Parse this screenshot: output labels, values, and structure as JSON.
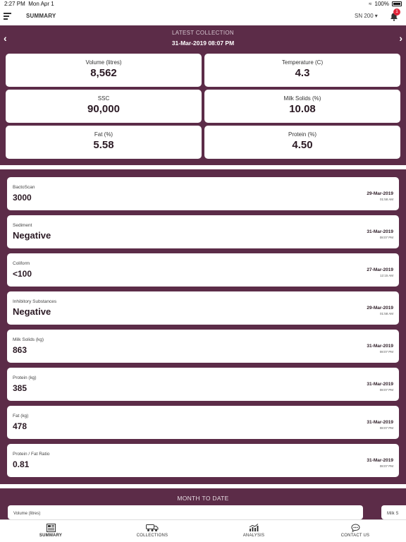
{
  "status_bar": {
    "time": "2:27 PM",
    "date": "Mon Apr 1",
    "battery": "100%"
  },
  "header": {
    "title": "SUMMARY",
    "site_select": "SN 200",
    "notification_count": "1"
  },
  "latest": {
    "label": "LATEST COLLECTION",
    "datetime": "31-Mar-2019 08:07 PM",
    "metrics": [
      {
        "label": "Volume (litres)",
        "value": "8,562"
      },
      {
        "label": "Temperature (C)",
        "value": "4.3"
      },
      {
        "label": "SSC",
        "value": "90,000"
      },
      {
        "label": "Milk Solids (%)",
        "value": "10.08"
      },
      {
        "label": "Fat (%)",
        "value": "5.58"
      },
      {
        "label": "Protein (%)",
        "value": "4.50"
      }
    ]
  },
  "tests": [
    {
      "label": "BactoScan",
      "value": "3000",
      "date": "29-Mar-2019",
      "time": "01:58 AM"
    },
    {
      "label": "Sediment",
      "value": "Negative",
      "date": "31-Mar-2019",
      "time": "08:07 PM"
    },
    {
      "label": "Coliform",
      "value": "<100",
      "date": "27-Mar-2019",
      "time": "12:15 AM"
    },
    {
      "label": "Inhibitory Substances",
      "value": "Negative",
      "date": "29-Mar-2019",
      "time": "01:58 AM"
    },
    {
      "label": "Milk Solids (kg)",
      "value": "863",
      "date": "31-Mar-2019",
      "time": "08:07 PM"
    },
    {
      "label": "Protein (kg)",
      "value": "385",
      "date": "31-Mar-2019",
      "time": "08:07 PM"
    },
    {
      "label": "Fat (kg)",
      "value": "478",
      "date": "31-Mar-2019",
      "time": "08:07 PM"
    },
    {
      "label": "Protein / Fat Ratio",
      "value": "0.81",
      "date": "31-Mar-2019",
      "time": "08:07 PM"
    }
  ],
  "month_to_date": {
    "label": "MONTH TO DATE",
    "cards": [
      {
        "label": "Volume (litres)"
      },
      {
        "label": "Milk S"
      }
    ]
  },
  "tabs": [
    {
      "label": "SUMMARY",
      "icon": "summary-icon",
      "active": true
    },
    {
      "label": "COLLECTIONS",
      "icon": "truck-icon",
      "active": false
    },
    {
      "label": "ANALYSIS",
      "icon": "chart-icon",
      "active": false
    },
    {
      "label": "CONTACT US",
      "icon": "chat-icon",
      "active": false
    }
  ],
  "colors": {
    "brand_purple": "#5c2c48",
    "badge_red": "#e0263a",
    "text_dark": "#2b1a24"
  }
}
